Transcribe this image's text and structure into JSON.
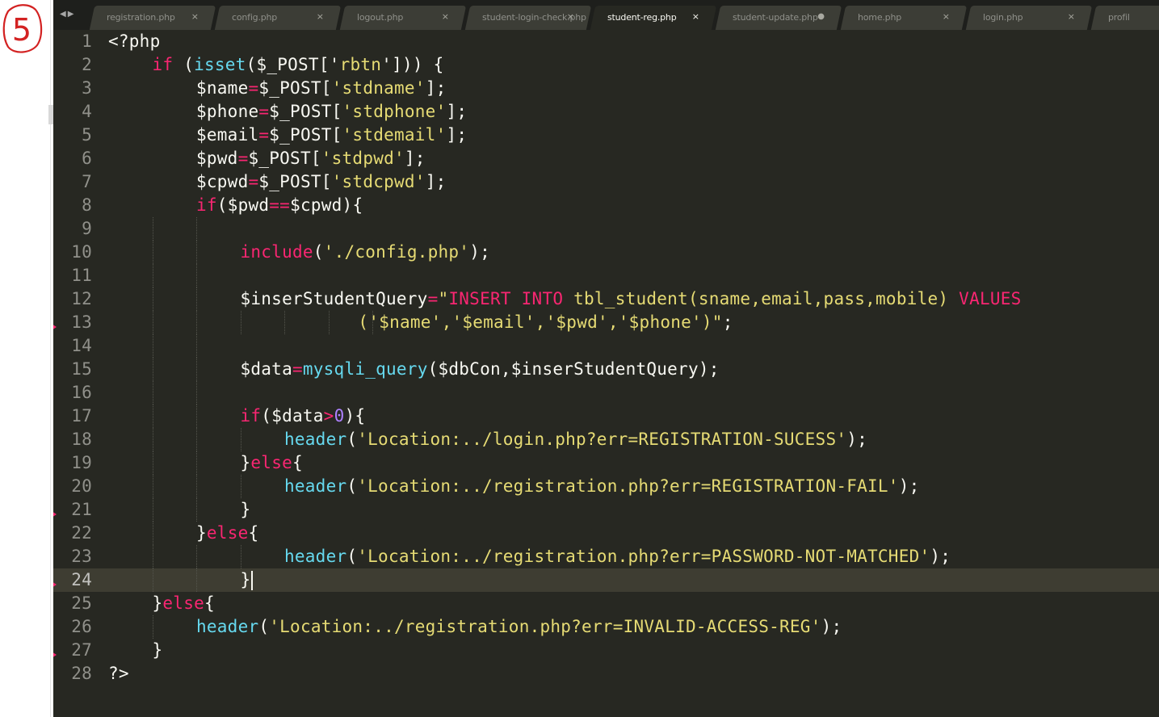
{
  "annotation": {
    "number": "5"
  },
  "tabbar": {
    "nav_arrows": "◀▶",
    "tabs": [
      {
        "label": "registration.php",
        "close": "×",
        "active": false
      },
      {
        "label": "config.php",
        "close": "×",
        "active": false
      },
      {
        "label": "logout.php",
        "close": "×",
        "active": false
      },
      {
        "label": "student-login-check.php",
        "close": "×",
        "active": false
      },
      {
        "label": "student-reg.php",
        "close": "×",
        "active": true
      },
      {
        "label": "student-update.php",
        "close": "●",
        "active": false
      },
      {
        "label": "home.php",
        "close": "×",
        "active": false
      },
      {
        "label": "login.php",
        "close": "×",
        "active": false
      },
      {
        "label": "profil",
        "close": "",
        "active": false
      }
    ]
  },
  "editor": {
    "current_line": 24,
    "lines": [
      {
        "n": "1",
        "indent": 0,
        "tokens": [
          [
            "tag",
            "<?php"
          ]
        ]
      },
      {
        "n": "2",
        "indent": 1,
        "tokens": [
          [
            "kw",
            "if"
          ],
          [
            "pun",
            " ("
          ],
          [
            "fn",
            "isset"
          ],
          [
            "pun",
            "("
          ],
          [
            "var",
            "$_POST"
          ],
          [
            "pun",
            "['"
          ],
          [
            "str",
            "rbtn"
          ],
          [
            "pun",
            "'])) {"
          ]
        ]
      },
      {
        "n": "3",
        "indent": 2,
        "tokens": [
          [
            "var",
            "$name"
          ],
          [
            "op",
            "="
          ],
          [
            "var",
            "$_POST"
          ],
          [
            "pun",
            "["
          ],
          [
            "str",
            "'stdname'"
          ],
          [
            "pun",
            "];"
          ]
        ]
      },
      {
        "n": "4",
        "indent": 2,
        "tokens": [
          [
            "var",
            "$phone"
          ],
          [
            "op",
            "="
          ],
          [
            "var",
            "$_POST"
          ],
          [
            "pun",
            "["
          ],
          [
            "str",
            "'stdphone'"
          ],
          [
            "pun",
            "];"
          ]
        ]
      },
      {
        "n": "5",
        "indent": 2,
        "tokens": [
          [
            "var",
            "$email"
          ],
          [
            "op",
            "="
          ],
          [
            "var",
            "$_POST"
          ],
          [
            "pun",
            "["
          ],
          [
            "str",
            "'stdemail'"
          ],
          [
            "pun",
            "];"
          ]
        ]
      },
      {
        "n": "6",
        "indent": 2,
        "tokens": [
          [
            "var",
            "$pwd"
          ],
          [
            "op",
            "="
          ],
          [
            "var",
            "$_POST"
          ],
          [
            "pun",
            "["
          ],
          [
            "str",
            "'stdpwd'"
          ],
          [
            "pun",
            "];"
          ]
        ]
      },
      {
        "n": "7",
        "indent": 2,
        "tokens": [
          [
            "var",
            "$cpwd"
          ],
          [
            "op",
            "="
          ],
          [
            "var",
            "$_POST"
          ],
          [
            "pun",
            "["
          ],
          [
            "str",
            "'stdcpwd'"
          ],
          [
            "pun",
            "];"
          ]
        ]
      },
      {
        "n": "8",
        "indent": 2,
        "tokens": [
          [
            "kw",
            "if"
          ],
          [
            "pun",
            "("
          ],
          [
            "var",
            "$pwd"
          ],
          [
            "op",
            "=="
          ],
          [
            "var",
            "$cpwd"
          ],
          [
            "pun",
            "){"
          ]
        ]
      },
      {
        "n": "9",
        "indent": 0,
        "tokens": []
      },
      {
        "n": "10",
        "indent": 3,
        "tokens": [
          [
            "kw",
            "include"
          ],
          [
            "pun",
            "("
          ],
          [
            "str",
            "'./config.php'"
          ],
          [
            "pun",
            ");"
          ]
        ]
      },
      {
        "n": "11",
        "indent": 0,
        "tokens": []
      },
      {
        "n": "12",
        "indent": 3,
        "tokens": [
          [
            "var",
            "$inserStudentQuery"
          ],
          [
            "op",
            "="
          ],
          [
            "str",
            "\""
          ],
          [
            "kw",
            "INSERT"
          ],
          [
            "str",
            " "
          ],
          [
            "kw",
            "INTO"
          ],
          [
            "str",
            " tbl_student(sname,email,pass,mobile) "
          ],
          [
            "kw",
            "VALUES"
          ]
        ]
      },
      {
        "n": "13",
        "indent": 0,
        "tokens": [
          [
            "str",
            "                        ('$name','$email','$pwd','$phone')\""
          ],
          [
            "pun",
            ";"
          ]
        ]
      },
      {
        "n": "14",
        "indent": 0,
        "tokens": []
      },
      {
        "n": "15",
        "indent": 3,
        "tokens": [
          [
            "var",
            "$data"
          ],
          [
            "op",
            "="
          ],
          [
            "fn",
            "mysqli_query"
          ],
          [
            "pun",
            "("
          ],
          [
            "var",
            "$dbCon"
          ],
          [
            "pun",
            ","
          ],
          [
            "var",
            "$inserStudentQuery"
          ],
          [
            "pun",
            ");"
          ]
        ]
      },
      {
        "n": "16",
        "indent": 0,
        "tokens": []
      },
      {
        "n": "17",
        "indent": 3,
        "tokens": [
          [
            "kw",
            "if"
          ],
          [
            "pun",
            "("
          ],
          [
            "var",
            "$data"
          ],
          [
            "op",
            ">"
          ],
          [
            "num",
            "0"
          ],
          [
            "pun",
            "){"
          ]
        ]
      },
      {
        "n": "18",
        "indent": 4,
        "tokens": [
          [
            "fn",
            "header"
          ],
          [
            "pun",
            "("
          ],
          [
            "str",
            "'Location:../login.php?err=REGISTRATION-SUCESS'"
          ],
          [
            "pun",
            ");"
          ]
        ]
      },
      {
        "n": "19",
        "indent": 3,
        "tokens": [
          [
            "pun",
            "}"
          ],
          [
            "kw",
            "else"
          ],
          [
            "pun",
            "{"
          ]
        ]
      },
      {
        "n": "20",
        "indent": 4,
        "tokens": [
          [
            "fn",
            "header"
          ],
          [
            "pun",
            "("
          ],
          [
            "str",
            "'Location:../registration.php?err=REGISTRATION-FAIL'"
          ],
          [
            "pun",
            ");"
          ]
        ]
      },
      {
        "n": "21",
        "indent": 3,
        "tokens": [
          [
            "pun",
            "}"
          ]
        ]
      },
      {
        "n": "22",
        "indent": 2,
        "tokens": [
          [
            "pun",
            "}"
          ],
          [
            "kw",
            "else"
          ],
          [
            "pun",
            "{"
          ]
        ]
      },
      {
        "n": "23",
        "indent": 4,
        "tokens": [
          [
            "fn",
            "header"
          ],
          [
            "pun",
            "("
          ],
          [
            "str",
            "'Location:../registration.php?err=PASSWORD-NOT-MATCHED'"
          ],
          [
            "pun",
            ");"
          ]
        ]
      },
      {
        "n": "24",
        "indent": 3,
        "tokens": [
          [
            "pun",
            "}"
          ]
        ]
      },
      {
        "n": "25",
        "indent": 1,
        "tokens": [
          [
            "pun",
            "}"
          ],
          [
            "kw",
            "else"
          ],
          [
            "pun",
            "{"
          ]
        ]
      },
      {
        "n": "26",
        "indent": 2,
        "tokens": [
          [
            "fn",
            "header"
          ],
          [
            "pun",
            "("
          ],
          [
            "str",
            "'Location:../registration.php?err=INVALID-ACCESS-REG'"
          ],
          [
            "pun",
            ");"
          ]
        ]
      },
      {
        "n": "27",
        "indent": 1,
        "tokens": [
          [
            "pun",
            "}"
          ]
        ]
      },
      {
        "n": "28",
        "indent": 0,
        "tokens": [
          [
            "tag",
            "?>"
          ]
        ]
      }
    ]
  }
}
